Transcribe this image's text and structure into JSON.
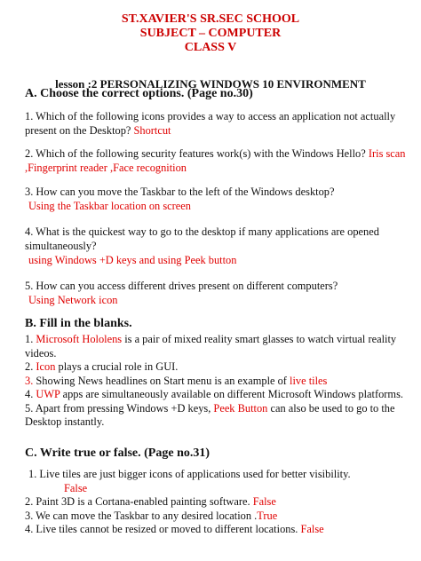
{
  "header": {
    "school": "ST.XAVIER'S SR.SEC SCHOOL",
    "subject": "SUBJECT – COMPUTER",
    "class": "CLASS V"
  },
  "lesson_title": "lesson :2 PERSONALIZING WINDOWS 10 ENVIRONMENT",
  "section_a": {
    "title": "A. Choose the correct options. (Page no.30)",
    "questions": [
      {
        "q": "1. Which of the following icons provides a way to access an application not actually present on the Desktop?",
        "a": "Shortcut"
      },
      {
        "q": "2. Which of the following security features work(s) with the Windows Hello?",
        "a": "Iris scan ,Fingerprint reader ,Face recognition"
      },
      {
        "q": "3. How can you move the Taskbar to the left of the Windows desktop?",
        "a": "Using the Taskbar location on screen"
      },
      {
        "q": "4. What is the quickest way to go to the desktop if many applications are opened simultaneously?",
        "a": "using Windows +D keys and using Peek button"
      },
      {
        "q": "5. How can you access different drives present on different computers?",
        "a": "Using Network icon"
      }
    ]
  },
  "section_b": {
    "title": "B. Fill in the blanks.",
    "items": [
      {
        "num": "1.",
        "pre": "",
        "ans": "Microsoft Hololens",
        "post": " is a pair of mixed reality smart glasses to watch virtual reality videos."
      },
      {
        "num": "2.",
        "pre": "",
        "ans": "Icon",
        "post": " plays a crucial role in GUI."
      },
      {
        "num": "3.",
        "pre": "Showing News headlines on Start menu is an example of ",
        "ans": "live tiles",
        "post": ""
      },
      {
        "num": "4.",
        "pre": "",
        "ans": "UWP",
        "post": " apps are simultaneously available on different Microsoft Windows platforms."
      },
      {
        "num": "5.",
        "pre": "Apart from pressing Windows +D keys, ",
        "ans": "Peek Button",
        "post": " can also be used to go to the Desktop instantly."
      }
    ]
  },
  "section_c": {
    "title": "C. Write true or false. (Page no.31)",
    "items": [
      {
        "q": "1. Live tiles are just bigger icons of applications used for better visibility.",
        "a": "False"
      },
      {
        "q": "2. Paint 3D is a Cortana-enabled painting software.",
        "a": "False"
      },
      {
        "q": "3. We can move the Taskbar to any desired location .",
        "a": "True"
      },
      {
        "q": "4. Live tiles cannot be resized or moved to different locations.",
        "a": "False"
      }
    ]
  }
}
